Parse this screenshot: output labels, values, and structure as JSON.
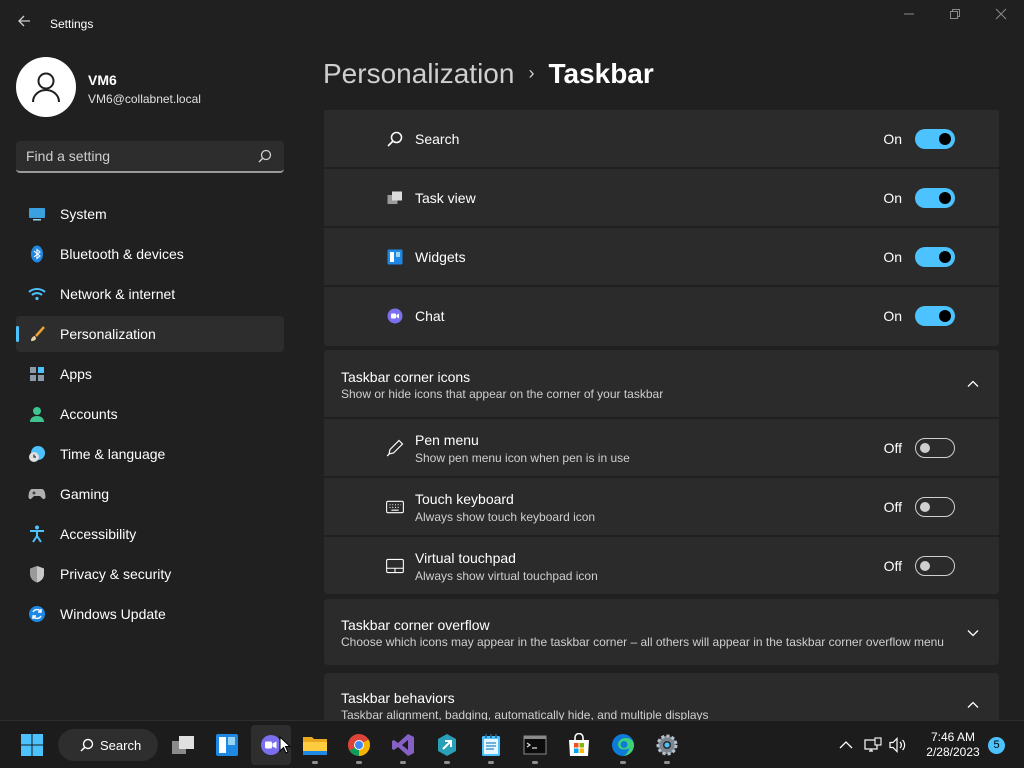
{
  "app": {
    "title": "Settings"
  },
  "user": {
    "name": "VM6",
    "email": "VM6@collabnet.local"
  },
  "search": {
    "placeholder": "Find a setting"
  },
  "nav": {
    "items": [
      {
        "label": "System",
        "icon": "system-icon"
      },
      {
        "label": "Bluetooth & devices",
        "icon": "bluetooth-icon"
      },
      {
        "label": "Network & internet",
        "icon": "wifi-icon"
      },
      {
        "label": "Personalization",
        "icon": "brush-icon",
        "selected": true
      },
      {
        "label": "Apps",
        "icon": "apps-icon"
      },
      {
        "label": "Accounts",
        "icon": "person-icon"
      },
      {
        "label": "Time & language",
        "icon": "clock-globe-icon"
      },
      {
        "label": "Gaming",
        "icon": "gamepad-icon"
      },
      {
        "label": "Accessibility",
        "icon": "accessibility-icon"
      },
      {
        "label": "Privacy & security",
        "icon": "shield-icon"
      },
      {
        "label": "Windows Update",
        "icon": "update-icon"
      }
    ]
  },
  "header": {
    "parent": "Personalization",
    "separator": "›",
    "current": "Taskbar"
  },
  "taskbar_items": [
    {
      "label": "Search",
      "state": "On",
      "on": true,
      "icon": "search-icon"
    },
    {
      "label": "Task view",
      "state": "On",
      "on": true,
      "icon": "task-view-icon"
    },
    {
      "label": "Widgets",
      "state": "On",
      "on": true,
      "icon": "widgets-icon"
    },
    {
      "label": "Chat",
      "state": "On",
      "on": true,
      "icon": "chat-icon"
    }
  ],
  "corner_icons": {
    "title": "Taskbar corner icons",
    "subtitle": "Show or hide icons that appear on the corner of your taskbar",
    "expanded": true,
    "items": [
      {
        "label": "Pen menu",
        "subtitle": "Show pen menu icon when pen is in use",
        "state": "Off",
        "on": false,
        "icon": "pen-icon"
      },
      {
        "label": "Touch keyboard",
        "subtitle": "Always show touch keyboard icon",
        "state": "Off",
        "on": false,
        "icon": "keyboard-icon"
      },
      {
        "label": "Virtual touchpad",
        "subtitle": "Always show virtual touchpad icon",
        "state": "Off",
        "on": false,
        "icon": "touchpad-icon"
      }
    ]
  },
  "corner_overflow": {
    "title": "Taskbar corner overflow",
    "subtitle": "Choose which icons may appear in the taskbar corner – all others will appear in the taskbar corner overflow menu",
    "expanded": false
  },
  "behaviors": {
    "title": "Taskbar behaviors",
    "subtitle": "Taskbar alignment, badging, automatically hide, and multiple displays",
    "expanded": true
  },
  "taskbar": {
    "search_label": "Search",
    "apps": [
      "start-icon",
      "task-view-icon",
      "widgets-icon",
      "teams-chat-icon",
      "file-explorer-icon",
      "chrome-icon",
      "visual-studio-icon",
      "azure-data-studio-icon",
      "notepad-icon",
      "terminal-icon",
      "store-icon",
      "edge-icon",
      "settings-icon"
    ],
    "time": "7:46 AM",
    "date": "2/28/2023",
    "notifications": "5"
  },
  "colors": {
    "accent": "#4cc2ff",
    "background": "#202020",
    "card": "#2b2b2b"
  }
}
